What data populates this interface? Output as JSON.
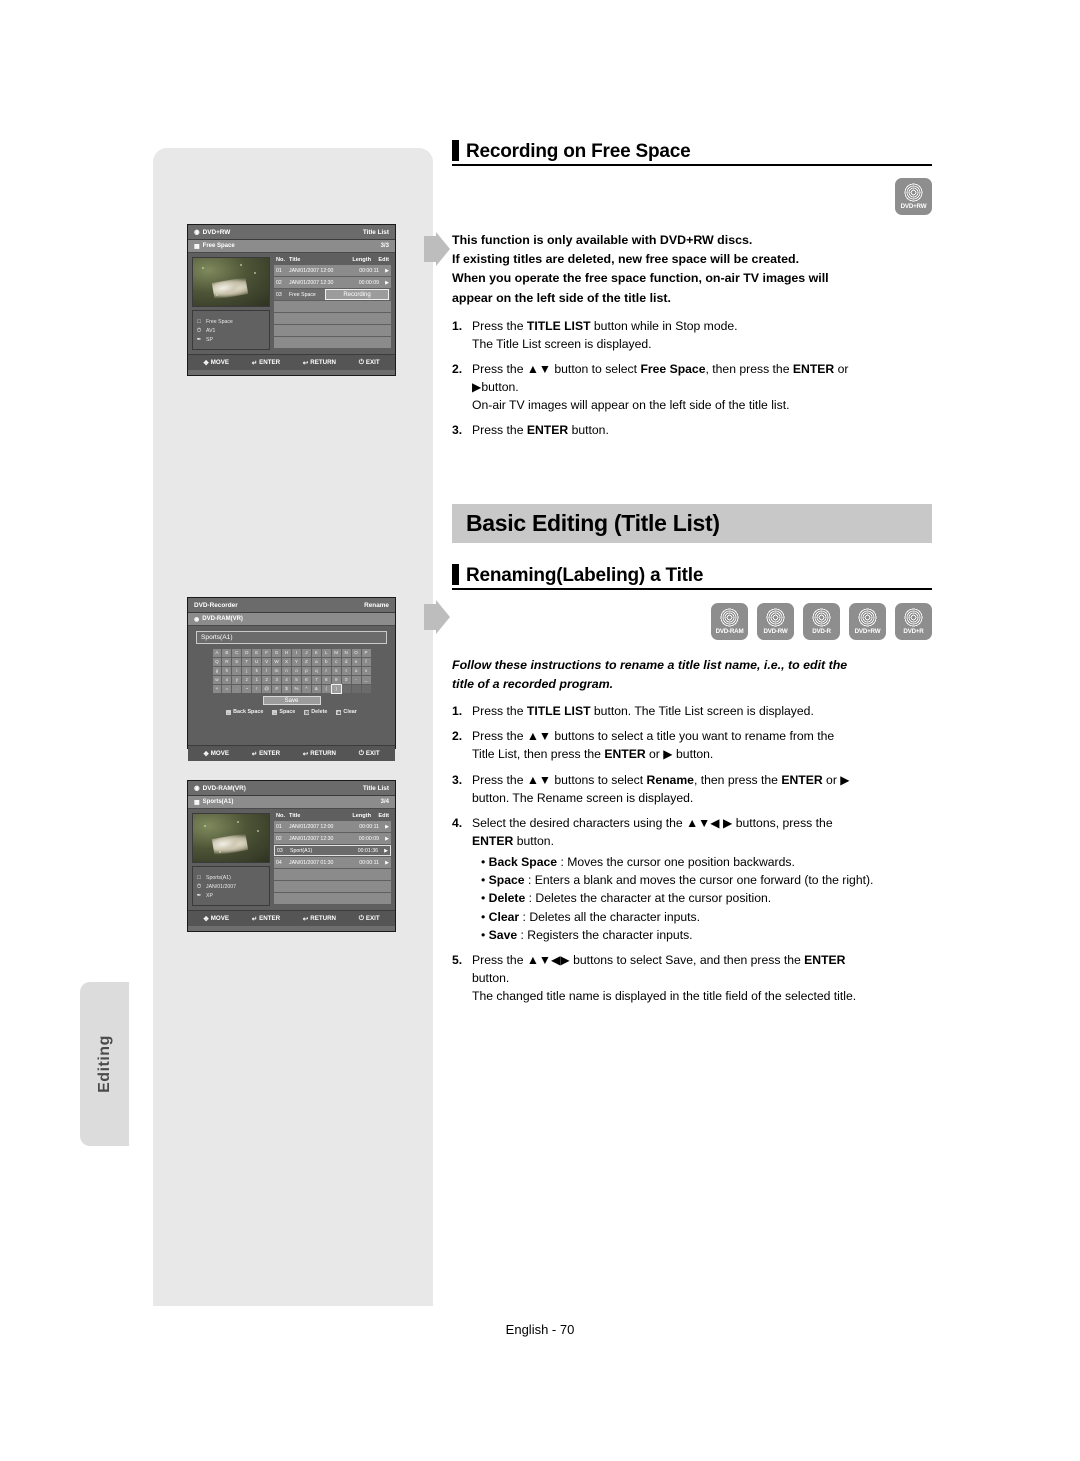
{
  "page": {
    "footer": "English - 70",
    "side_tab": "Editing"
  },
  "sections": {
    "recording_free_space": {
      "heading": "Recording on Free Space",
      "badge": "DVD+RW",
      "lead": [
        "This function is only available with DVD+RW discs.",
        "If existing titles are deleted, new free space will be created.",
        "When you operate the free space function, on-air TV images will",
        "appear on the left side of the title list."
      ],
      "steps": [
        {
          "num": "1.",
          "lines": [
            "Press the <b>TITLE LIST</b> button while in Stop mode.",
            "The Title List screen is displayed."
          ]
        },
        {
          "num": "2.",
          "lines": [
            "Press the ▲▼ button to select <b>Free Space</b>, then press the <b>ENTER</b> or",
            "▶button.",
            "On-air TV images will appear on the left side of the title list."
          ]
        },
        {
          "num": "3.",
          "lines": [
            "Press the <b>ENTER</b> button."
          ]
        }
      ]
    },
    "basic_editing": {
      "banner": "Basic Editing (Title List)",
      "heading": "Renaming(Labeling) a Title",
      "badges": [
        "DVD-RAM",
        "DVD-RW",
        "DVD-R",
        "DVD+RW",
        "DVD+R"
      ],
      "lead_italic": [
        "Follow these instructions to rename a title list name, i.e., to edit the",
        "title of a recorded program."
      ],
      "steps": [
        {
          "num": "1.",
          "lines": [
            "Press the <b>TITLE LIST</b> button. The Title List screen is displayed."
          ]
        },
        {
          "num": "2.",
          "lines": [
            "Press the ▲▼ buttons to select a title you want to rename from the",
            "Title List, then press the <b>ENTER</b> or ▶ button."
          ]
        },
        {
          "num": "3.",
          "lines": [
            "Press the ▲▼ buttons to select <b>Rename</b>, then press the <b>ENTER</b> or ▶",
            "button. The Rename screen is displayed."
          ]
        },
        {
          "num": "4.",
          "lines": [
            "Select the desired characters using the ▲▼◀ ▶ buttons, press the",
            "<b>ENTER</b> button."
          ],
          "bullets": [
            "• <b>Back Space</b> : Moves the cursor one position backwards.",
            "• <b>Space</b> : Enters a blank and moves the cursor one forward (to the right).",
            "• <b>Delete</b> : Deletes the character at the cursor position.",
            "• <b>Clear</b> : Deletes all the character inputs.",
            "• <b>Save</b> : Registers the character inputs."
          ]
        },
        {
          "num": "5.",
          "lines": [
            "Press the ▲▼◀▶ buttons to select Save, and then press the <b>ENTER</b>",
            "button.",
            "The changed title name is displayed in the title field of the selected title."
          ]
        }
      ]
    }
  },
  "osd_free_space": {
    "disc_label": "DVD+RW",
    "mode_label": "Title List",
    "sub_label": "Free Space",
    "page_count": "3/3",
    "columns": {
      "no": "No.",
      "title": "Title",
      "length": "Length",
      "edit": "Edit"
    },
    "rows": [
      {
        "no": "01",
        "title": "JAN/01/2007  12:00",
        "length": "00:00:11",
        "edit": "▶",
        "state": "normal"
      },
      {
        "no": "02",
        "title": "JAN/01/2007  12:30",
        "length": "00:00:09",
        "edit": "▶",
        "state": "normal"
      },
      {
        "no": "03",
        "title": "Free Space",
        "length": "",
        "edit": "",
        "state": "selected"
      }
    ],
    "popup": "Recording",
    "info": [
      {
        "glyph": "□",
        "text": "Free Space"
      },
      {
        "glyph": "⏱",
        "text": "AV1"
      },
      {
        "glyph": "✒",
        "text": "SP"
      }
    ],
    "footer": [
      {
        "glyph": "✥",
        "label": "MOVE"
      },
      {
        "glyph": "↵",
        "label": "ENTER"
      },
      {
        "glyph": "↩",
        "label": "RETURN"
      },
      {
        "glyph": "⏻",
        "label": "EXIT"
      }
    ]
  },
  "osd_rename": {
    "device_label": "DVD-Recorder",
    "mode_label": "Rename",
    "disc_label": "DVD-RAM(VR)",
    "field_value": "Sports(A1)",
    "keyboard": [
      [
        "A",
        "B",
        "C",
        "D",
        "E",
        "F",
        "G",
        "H",
        "I",
        "J",
        "K",
        "L",
        "M",
        "N",
        "O",
        "P"
      ],
      [
        "Q",
        "R",
        "S",
        "T",
        "U",
        "V",
        "W",
        "X",
        "Y",
        "Z",
        "a",
        "b",
        "c",
        "d",
        "e",
        "f"
      ],
      [
        "g",
        "h",
        "i",
        "j",
        "k",
        "l",
        "m",
        "n",
        "o",
        "p",
        "q",
        "r",
        "s",
        "t",
        "u",
        "v"
      ],
      [
        "w",
        "x",
        "y",
        "z",
        "1",
        "2",
        "3",
        "4",
        "5",
        "6",
        "7",
        "8",
        "9",
        "0",
        "-",
        "_"
      ],
      [
        "+",
        "=",
        ".",
        "~",
        "!",
        "@",
        "#",
        "$",
        "%",
        "^",
        "&",
        "(",
        ")",
        "",
        "",
        ""
      ]
    ],
    "cursor": {
      "row": 4,
      "col": 12
    },
    "save_label": "Save",
    "hints": [
      {
        "glyph": "←",
        "label": "Back Space"
      },
      {
        "glyph": "↔",
        "label": "Space"
      },
      {
        "glyph": "☒",
        "label": "Delete"
      },
      {
        "glyph": "⊗",
        "label": "Clear"
      }
    ],
    "footer": [
      {
        "glyph": "✥",
        "label": "MOVE"
      },
      {
        "glyph": "↵",
        "label": "ENTER"
      },
      {
        "glyph": "↩",
        "label": "RETURN"
      },
      {
        "glyph": "⏻",
        "label": "EXIT"
      }
    ]
  },
  "osd_title_list": {
    "disc_label": "DVD-RAM(VR)",
    "mode_label": "Title List",
    "sub_label": "Sports(A1)",
    "page_count": "3/4",
    "columns": {
      "no": "No.",
      "title": "Title",
      "length": "Length",
      "edit": "Edit"
    },
    "rows": [
      {
        "no": "01",
        "title": "JAN/01/2007  12:00",
        "length": "00:00:11",
        "edit": "▶",
        "state": "normal"
      },
      {
        "no": "02",
        "title": "JAN/01/2007  12:30",
        "length": "00:00:09",
        "edit": "▶",
        "state": "normal"
      },
      {
        "no": "03",
        "title": "Sport(A1)",
        "length": "00:01:36",
        "edit": "▶",
        "state": "selected"
      },
      {
        "no": "04",
        "title": "JAN/01/2007  01:30",
        "length": "00:00:11",
        "edit": "▶",
        "state": "normal"
      }
    ],
    "info": [
      {
        "glyph": "□",
        "text": "Sports(A1)"
      },
      {
        "glyph": "⏱",
        "text": "JAN/01/2007"
      },
      {
        "glyph": "✒",
        "text": "XP"
      }
    ],
    "footer": [
      {
        "glyph": "✥",
        "label": "MOVE"
      },
      {
        "glyph": "↵",
        "label": "ENTER"
      },
      {
        "glyph": "↩",
        "label": "RETURN"
      },
      {
        "glyph": "⏻",
        "label": "EXIT"
      }
    ]
  }
}
